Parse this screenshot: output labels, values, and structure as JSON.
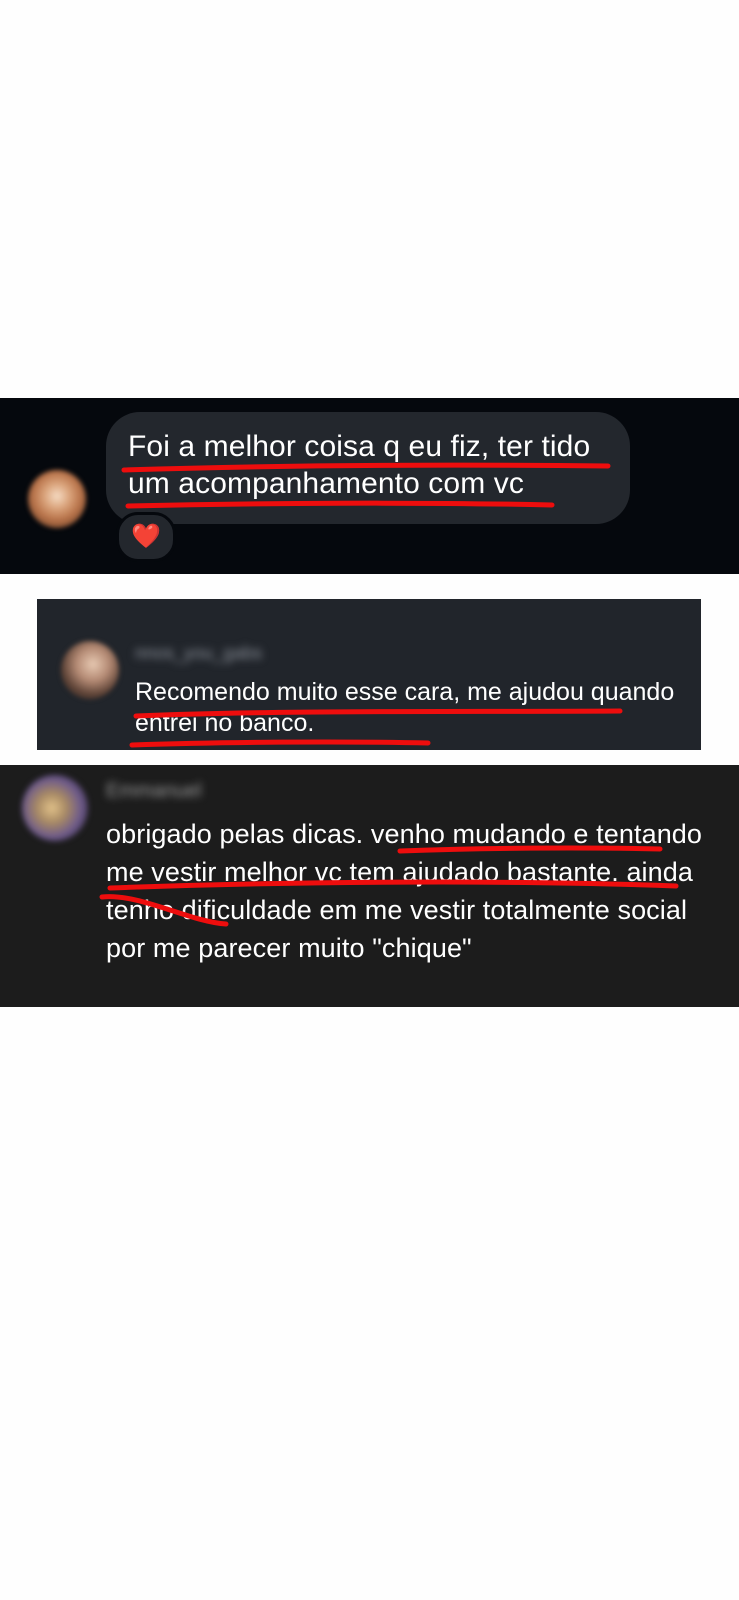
{
  "dm": {
    "message": "Foi a melhor coisa q eu fiz, ter tido um acompanhamento com vc",
    "reaction": "❤️"
  },
  "comment_1": {
    "username": "nnos_you_gabs",
    "text": "Recomendo muito esse cara, me ajudou quando entrei no banco."
  },
  "comment_2": {
    "username": "Emmanuel",
    "text": "obrigado pelas dicas. venho mudando e tentando me vestir melhor vc tem ajudado bastante. ainda tenho dificuldade em me vestir totalmente social por me parecer muito \"chique\""
  },
  "colors": {
    "panel_1_bg": "#05080d",
    "bubble_bg": "#23272d",
    "panel_2_bg": "#21252b",
    "panel_3_bg": "#1c1c1c",
    "underline": "#ee0d0d",
    "heart": "#ee1c25"
  }
}
